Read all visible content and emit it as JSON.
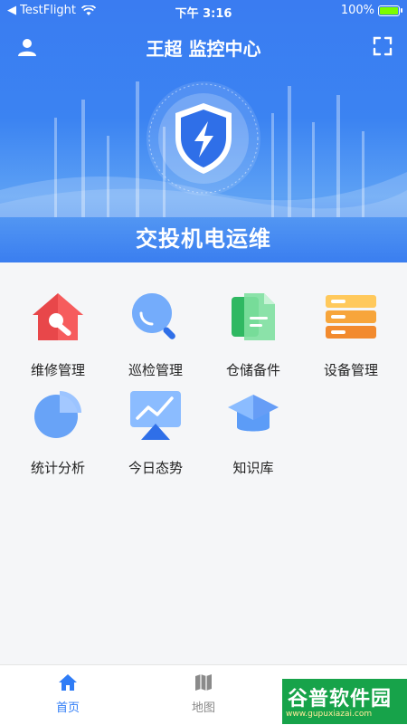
{
  "status_bar": {
    "back_label": "◀ TestFlight",
    "time": "下午 3:16",
    "battery_percent": "100%",
    "battery_level": 1.0
  },
  "header": {
    "title": "王超 监控中心",
    "hero_title": "交投机电运维",
    "icons": {
      "left": "user-icon",
      "right": "fullscreen-icon",
      "hero": "shield-lightning-icon"
    }
  },
  "menu": [
    {
      "label": "维修管理",
      "icon": "repair-house-icon"
    },
    {
      "label": "巡检管理",
      "icon": "magnifier-icon"
    },
    {
      "label": "仓储备件",
      "icon": "documents-icon"
    },
    {
      "label": "设备管理",
      "icon": "server-rack-icon"
    },
    {
      "label": "统计分析",
      "icon": "pie-chart-icon"
    },
    {
      "label": "今日态势",
      "icon": "trend-chart-icon"
    },
    {
      "label": "知识库",
      "icon": "graduation-cap-icon"
    }
  ],
  "tabs": [
    {
      "label": "首页",
      "icon": "home-icon",
      "active": true
    },
    {
      "label": "地图",
      "icon": "map-icon",
      "active": false
    }
  ],
  "watermark": {
    "main": "谷普软件园",
    "url": "www.gupuxiazai.com"
  },
  "colors": {
    "primary": "#2f7cf6",
    "header_blue": "#3a7cf1",
    "repair_red": "#e8474a",
    "storage_green": "#3fc46f",
    "device_orange": "#f7a53b"
  }
}
